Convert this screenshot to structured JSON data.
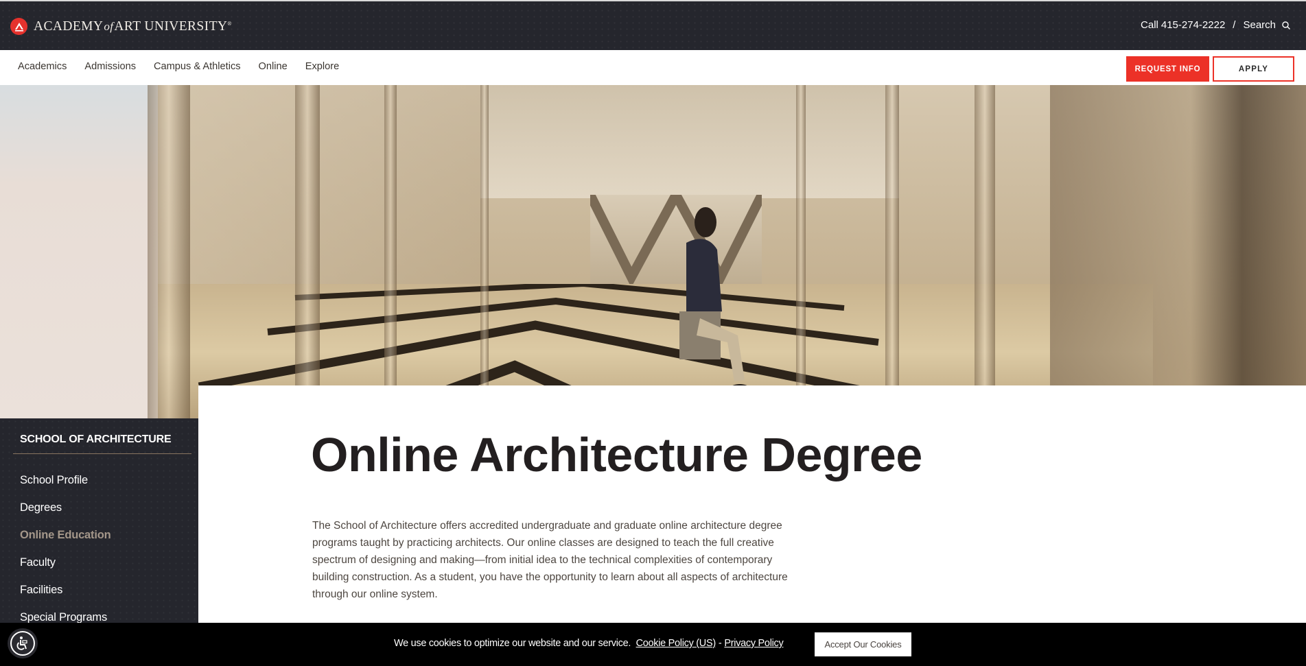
{
  "header": {
    "logo_text_1": "ACADEMY",
    "logo_text_of": "of",
    "logo_text_2": "ART UNIVERSITY",
    "logo_registered": "®",
    "call_label": "Call",
    "phone": "415-274-2222",
    "separator": "/",
    "search_label": "Search"
  },
  "nav": {
    "items": [
      {
        "label": "Academics"
      },
      {
        "label": "Admissions"
      },
      {
        "label": "Campus & Athletics"
      },
      {
        "label": "Online"
      },
      {
        "label": "Explore"
      }
    ],
    "request_info_label": "REQUEST INFO",
    "apply_label": "APPLY"
  },
  "sidebar": {
    "title": "SCHOOL OF ARCHITECTURE",
    "items": [
      {
        "label": "School Profile",
        "active": false
      },
      {
        "label": "Degrees",
        "active": false
      },
      {
        "label": "Online Education",
        "active": true
      },
      {
        "label": "Faculty",
        "active": false
      },
      {
        "label": "Facilities",
        "active": false
      },
      {
        "label": "Special Programs",
        "active": false
      }
    ]
  },
  "main": {
    "title": "Online Architecture Degree",
    "intro": "The School of Architecture offers accredited undergraduate and graduate online architecture degree programs taught by practicing architects. Our online classes are designed to teach the full creative spectrum of designing and making—from initial idea to the technical complexities of contemporary building construction. As a student, you have the opportunity to learn about all aspects of architecture through our online system."
  },
  "cookie_bar": {
    "message": "We use cookies to optimize our website and our service.",
    "cookie_policy_link": "Cookie Policy (US)",
    "separator": "-",
    "privacy_policy_link": "Privacy Policy",
    "accept_label": "Accept Our Cookies"
  },
  "colors": {
    "brand_red": "#ec3127",
    "dark_bg": "#25262d",
    "sidebar_active": "#a4978a"
  }
}
